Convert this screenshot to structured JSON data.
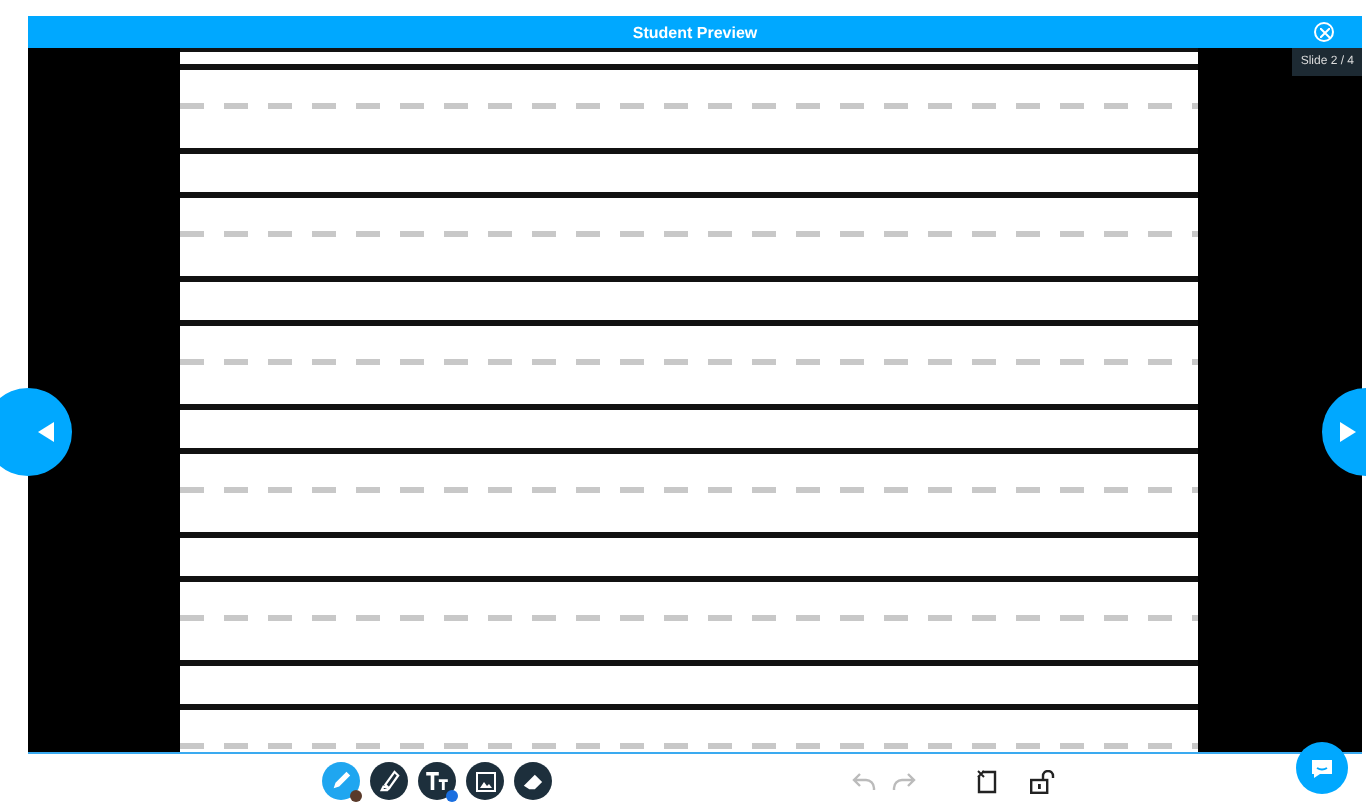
{
  "window": {
    "title": "Student Preview"
  },
  "slide_counter": "Slide 2 / 4",
  "tools": [
    {
      "kind": "pen",
      "selected": true
    },
    {
      "kind": "highlighter",
      "selected": false
    },
    {
      "kind": "text",
      "selected": false
    },
    {
      "kind": "image",
      "selected": false
    },
    {
      "kind": "eraser",
      "selected": false
    }
  ],
  "history": {
    "undo_disabled": true,
    "redo_disabled": true
  }
}
